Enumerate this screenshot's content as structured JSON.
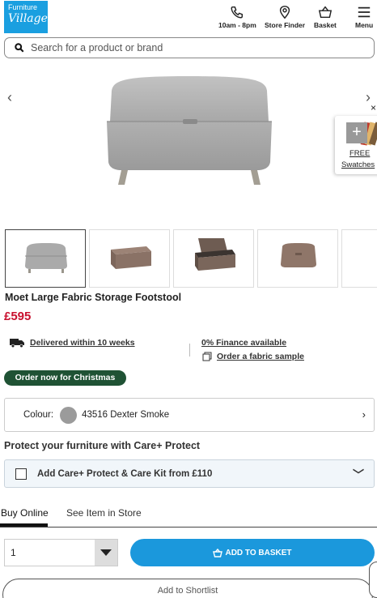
{
  "header": {
    "logo_line1": "Furniture",
    "logo_line2": "Village",
    "hours_label": "10am - 8pm",
    "store_finder_label": "Store Finder",
    "basket_label": "Basket",
    "menu_label": "Menu"
  },
  "search": {
    "placeholder": "Search for a product or brand"
  },
  "gallery": {
    "prev_arrow": "‹",
    "next_arrow": "›",
    "swatches_line1": "FREE",
    "swatches_line2": "Swatches",
    "close": "×",
    "plus": "+"
  },
  "product": {
    "title": "Moet Large Fabric Storage Footstool",
    "price": "£595",
    "delivery": "Delivered within 10 weeks",
    "finance": "0% Finance available",
    "sample": "Order a fabric sample",
    "badge": "Order now for Christmas"
  },
  "colour": {
    "label": "Colour:",
    "value": "43516 Dexter Smoke",
    "swatch_color": "#9b9b9b",
    "chevron": "›"
  },
  "protect": {
    "heading": "Protect your furniture with Care+ Protect",
    "option": "Add Care+ Protect & Care Kit from £110",
    "chevron": "﹀"
  },
  "tabs": [
    {
      "label": "Buy Online"
    },
    {
      "label": "See Item in Store"
    }
  ],
  "purchase": {
    "quantity": "1",
    "add_button": "ADD TO BASKET",
    "shortlist": "Add to Shortlist"
  },
  "colors": {
    "brand_blue": "#1a9fe0",
    "price_red": "#c8102e",
    "badge_green": "#1f5234"
  }
}
